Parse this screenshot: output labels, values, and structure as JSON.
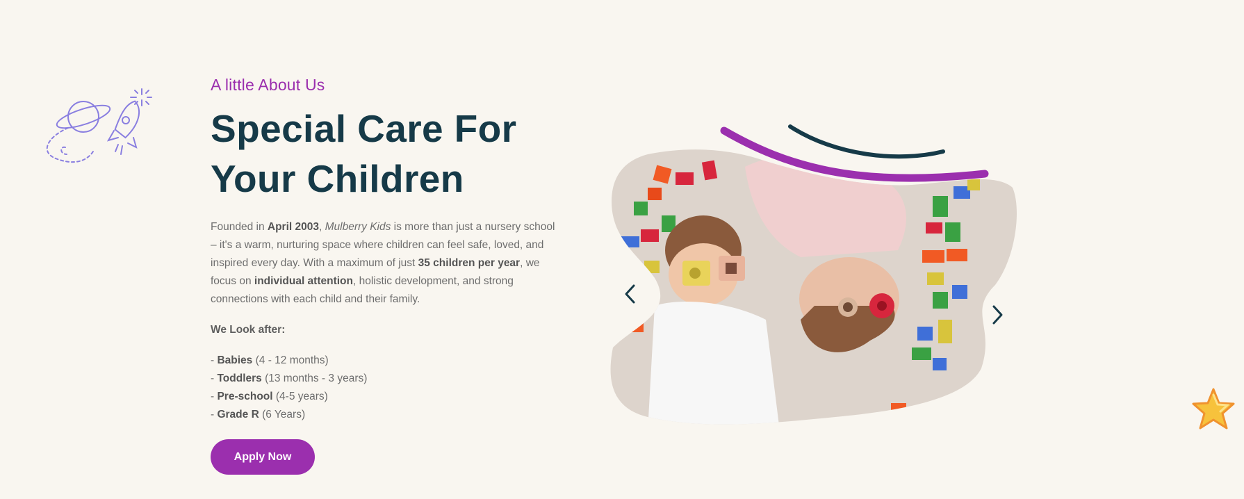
{
  "about": {
    "eyebrow": "A little About Us",
    "title_line1": "Special Care For",
    "title_line2": "Your Children",
    "intro": {
      "p1": "Founded in ",
      "date": "April 2003",
      "p2": ", ",
      "school": "Mulberry Kids",
      "p3": " is more than just a nursery school – it's a warm, nurturing space where children can feel safe, loved, and inspired every day. With a maximum of just ",
      "capacity": "35 children per year",
      "p4": ", we focus on ",
      "focus": "individual attention",
      "p5": ", holistic development, and strong connections with each child and their family."
    },
    "look_after_label": "We Look after:",
    "groups": [
      {
        "dash": "- ",
        "name": "Babies",
        "ages": " (4 - 12 months)"
      },
      {
        "dash": "- ",
        "name": "Toddlers",
        "ages": " (13 months - 3 years)"
      },
      {
        "dash": "- ",
        "name": "Pre-school",
        "ages": " (4-5 years)"
      },
      {
        "dash": "- ",
        "name": "Grade R",
        "ages": " (6 Years)"
      }
    ],
    "apply_label": "Apply Now"
  },
  "slider": {
    "prev_icon": "chevron-left-icon",
    "next_icon": "chevron-right-icon",
    "image": "children-playing-with-blocks-photo"
  },
  "decor": {
    "doodle": "planet-rocket-doodle-icon",
    "star": "star-icon"
  },
  "colors": {
    "background": "#f9f6f0",
    "accent": "#9b2fae",
    "heading": "#163a48",
    "body_text": "#6d6d6d",
    "star": "#f7c23c"
  }
}
